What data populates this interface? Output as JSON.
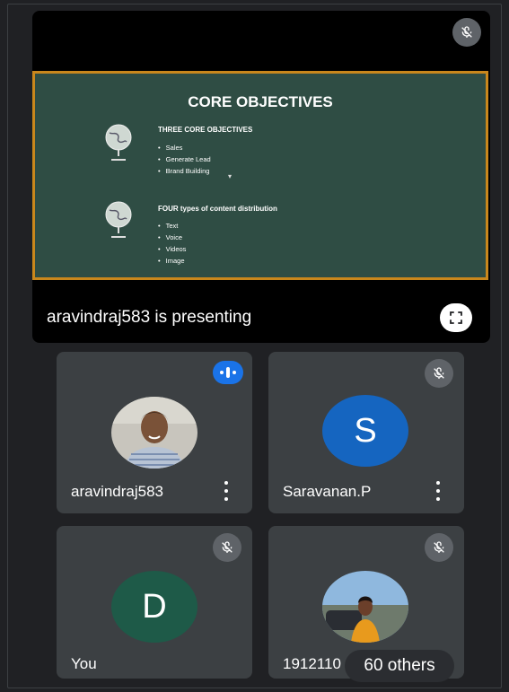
{
  "presentation": {
    "presenter_text": "aravindraj583 is presenting",
    "slide": {
      "title": "CORE OBJECTIVES",
      "section1": {
        "heading": "THREE CORE OBJECTIVES",
        "items": [
          "Sales",
          "Generate Lead",
          "Brand Building"
        ]
      },
      "section2": {
        "heading": "FOUR types of content distribution",
        "items": [
          "Text",
          "Voice",
          "Videos",
          "Image"
        ]
      }
    },
    "border_color": "#c9871c",
    "slide_bg": "#2f4d44"
  },
  "participants": [
    {
      "name": "aravindraj583",
      "avatar": "photo",
      "status": "speaking"
    },
    {
      "name": "Saravanan.P",
      "avatar_letter": "S",
      "avatar_color": "#1565c0",
      "status": "muted"
    },
    {
      "name": "You",
      "avatar_letter": "D",
      "avatar_color": "#1e5a48",
      "status": "muted"
    },
    {
      "name": "1912110",
      "avatar": "photo",
      "status": "muted"
    }
  ],
  "others_label": "60 others",
  "icons": {
    "muted": "mic-off-icon",
    "fullscreen": "fullscreen-icon",
    "speaking": "speaking-indicator-icon",
    "more": "more-vert-icon"
  }
}
